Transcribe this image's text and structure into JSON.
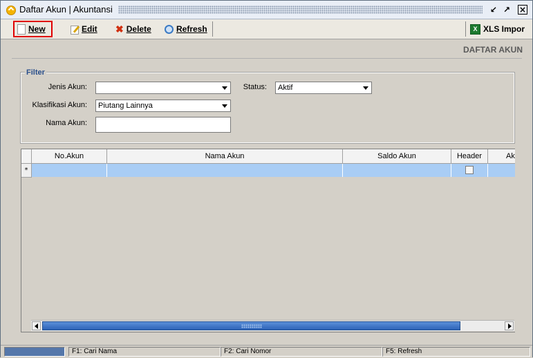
{
  "window": {
    "title": "Daftar Akun | Akuntansi",
    "controls": [
      "restore-icon",
      "maximize-icon",
      "close-icon"
    ]
  },
  "toolbar": {
    "new_label": "New",
    "edit_label": "Edit",
    "delete_label": "Delete",
    "refresh_label": "Refresh",
    "xls_label": "XLS Impor"
  },
  "page": {
    "section_title": "DAFTAR AKUN"
  },
  "filter": {
    "legend": "Filter",
    "jenis_akun": {
      "label": "Jenis Akun:",
      "value": ""
    },
    "status": {
      "label": "Status:",
      "value": "Aktif"
    },
    "klasifikasi_akun": {
      "label": "Klasifikasi Akun:",
      "value": "Piutang Lainnya"
    },
    "nama_akun": {
      "label": "Nama Akun:",
      "value": ""
    }
  },
  "grid": {
    "columns": [
      "No.Akun",
      "Nama Akun",
      "Saldo Akun",
      "Header",
      "Ak"
    ],
    "new_row_marker": "*"
  },
  "statusbar": {
    "items": [
      "F1: Cari Nama",
      "F2: Cari Nomor",
      "F5: Refresh"
    ]
  },
  "colors": {
    "selected_row": "#a9cdf5",
    "highlight_box": "#e00000",
    "scroll_thumb": "#2d63b8"
  }
}
